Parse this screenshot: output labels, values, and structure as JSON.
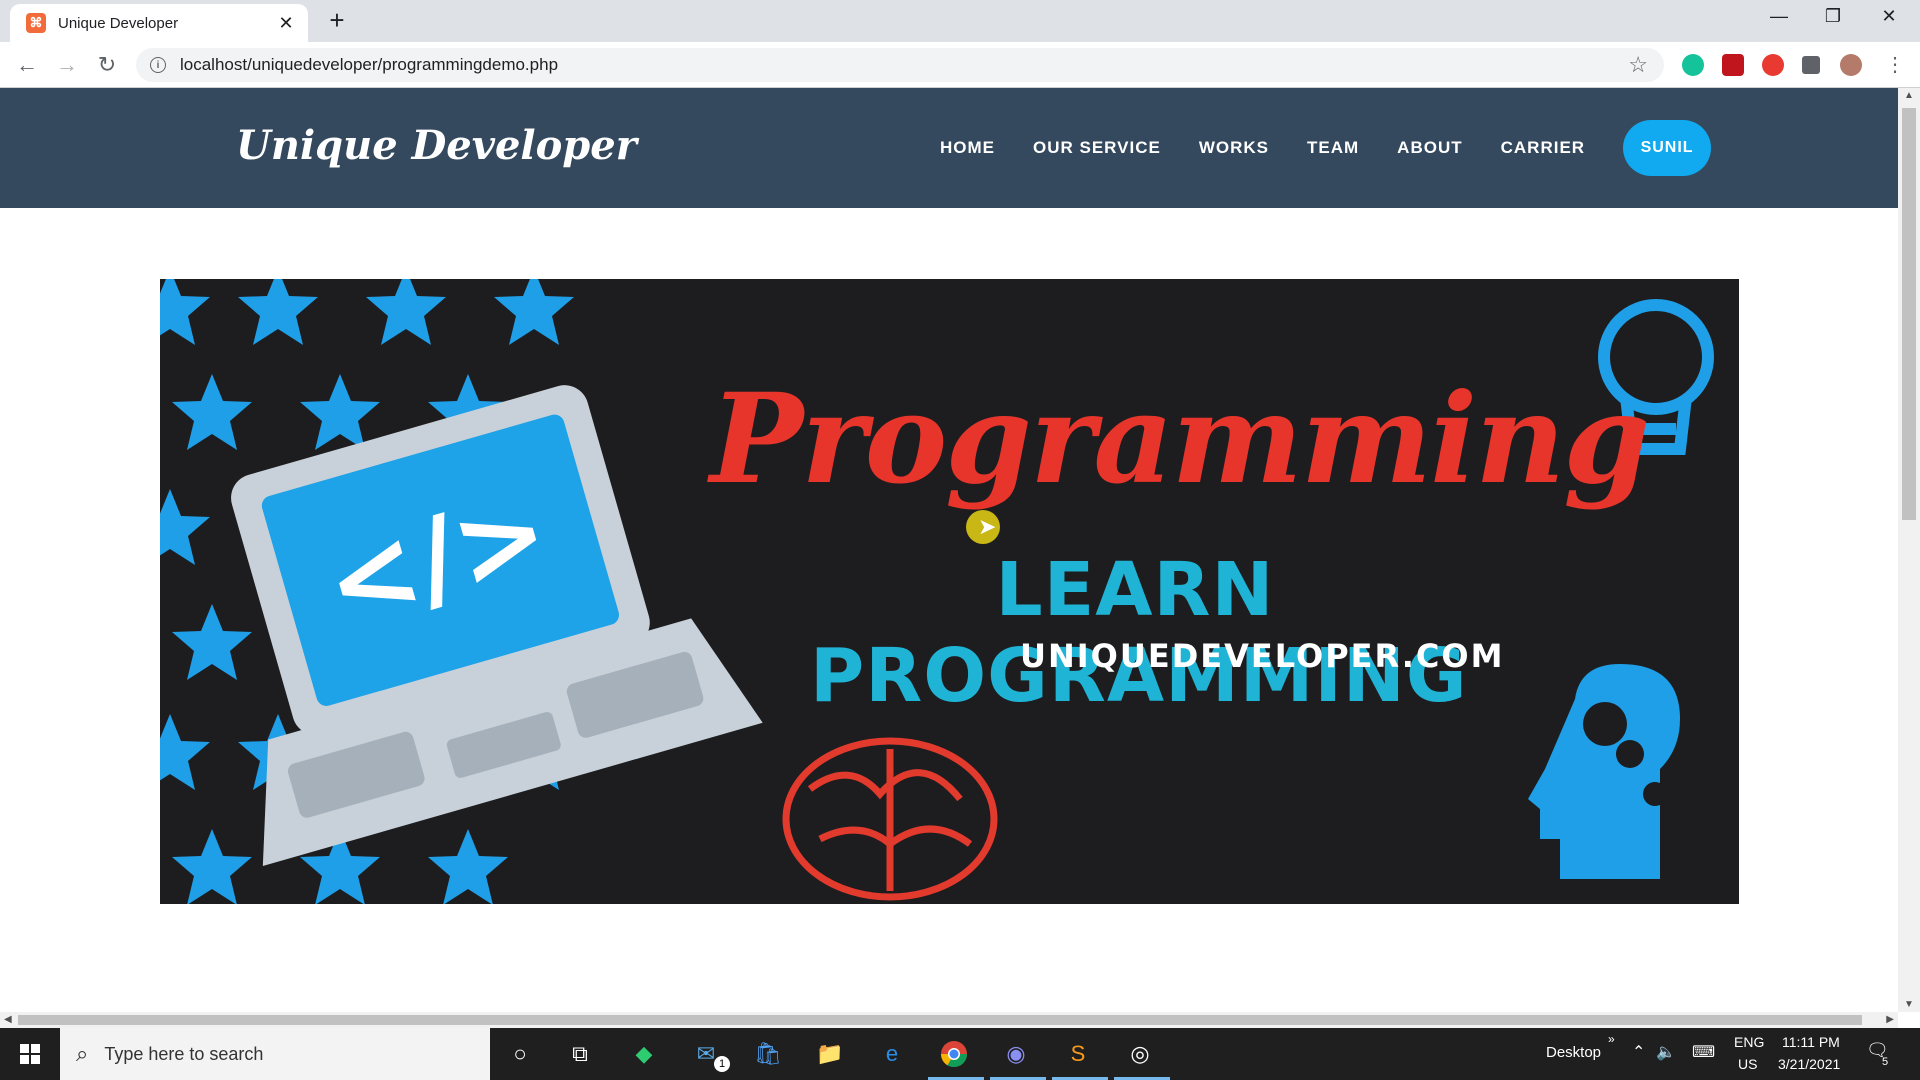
{
  "browser": {
    "tab_title": "Unique Developer",
    "tab_close": "✕",
    "new_tab": "+",
    "url": "localhost/uniquedeveloper/programmingdemo.php",
    "window_controls": [
      "—",
      "❐",
      "✕"
    ]
  },
  "site": {
    "logo": "Unique Developer",
    "nav": [
      "HOME",
      "OUR SERVICE",
      "WORKS",
      "TEAM",
      "ABOUT",
      "CARRIER"
    ],
    "user_button": "SUNIL",
    "header_color": "#34495e",
    "accent_color": "#11a9ef"
  },
  "banner": {
    "script_text": "Programming",
    "headline": "LEARN PROGRAMMING",
    "website": "UNIQUEDEVELOPER.COM",
    "laptop_code": "</>"
  },
  "taskbar": {
    "search_placeholder": "Type here to search",
    "desktop_label": "Desktop",
    "language": "ENG",
    "region": "US",
    "time": "11:11 PM",
    "date": "3/21/2021",
    "mail_badge": "1",
    "notification_count": "5"
  }
}
